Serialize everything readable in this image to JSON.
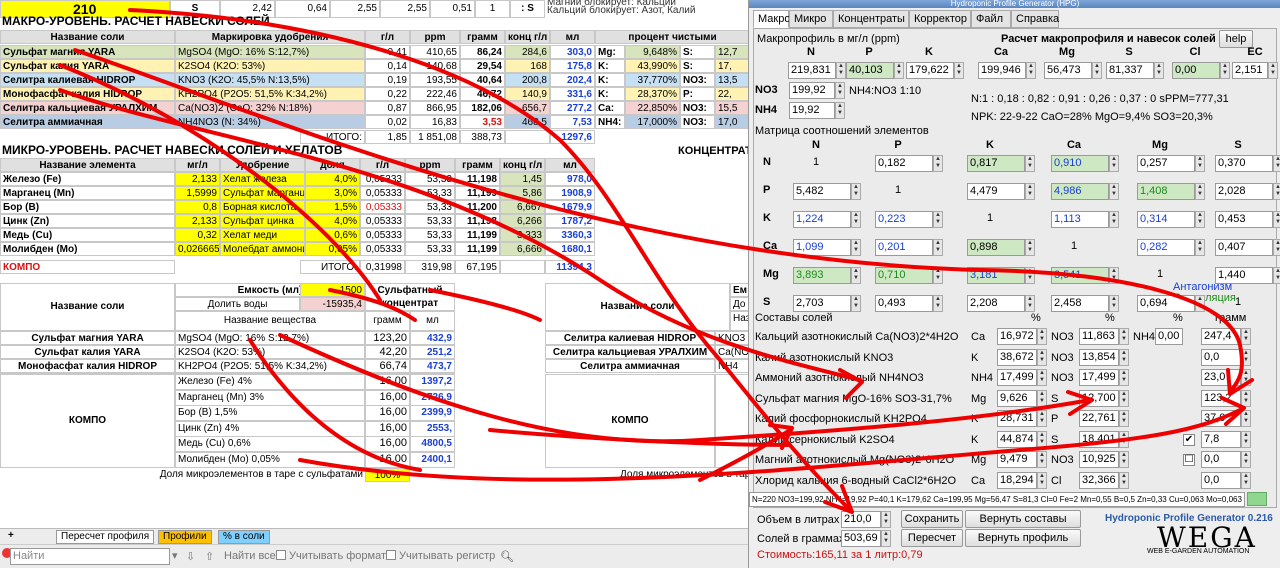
{
  "top": {
    "val210": "210",
    "s1": "S",
    "n1": "2,42",
    "n2": "0,64",
    "n3": "2,55",
    "n4": "2,55",
    "n5": "0,51",
    "n6": "1",
    "s2": ": S",
    "note1": "Магний блокирует: Кальций",
    "note2": "Кальций блокирует: Азот, Калий"
  },
  "macro": {
    "title": "МАКРО-УРОВЕНЬ. РАСЧЕТ НАВЕСКИ СОЛЕЙ",
    "h": [
      "Название соли",
      "Маркировка удобрения",
      "г/л",
      "ppm",
      "грамм",
      "конц г/л",
      "мл",
      "процент чистыми"
    ],
    "rows": [
      {
        "name": "Сульфат магния YARA",
        "mark": "MgSO4 (MgO: 16% S:12,7%)",
        "gl": "0,41",
        "ppm": "410,65",
        "g": "86,24",
        "k": "284,6",
        "ml": "303,0",
        "e1": "Mg:",
        "p1": "9,648%",
        "e2": "S:",
        "p2": "12,7"
      },
      {
        "name": "Сульфат калия YARA",
        "mark": "K2SO4 (K2O: 53%)",
        "gl": "0,14",
        "ppm": "140,68",
        "g": "29,54",
        "k": "168",
        "ml": "175,8",
        "e1": "K:",
        "p1": "43,990%",
        "e2": "S:",
        "p2": "17,"
      },
      {
        "name": "Селитра калиевая HIDROP",
        "mark": "KNO3 (K2O: 45,5% N:13,5%)",
        "gl": "0,19",
        "ppm": "193,55",
        "g": "40,64",
        "k": "200,8",
        "ml": "202,4",
        "e1": "K:",
        "p1": "37,770%",
        "e2": "NO3:",
        "p2": "13,5"
      },
      {
        "name": "Монофасфат калия HIDROP",
        "mark": "KH2PO4 (P2O5: 51,5% K:34,2%)",
        "gl": "0,22",
        "ppm": "222,46",
        "g": "46,72",
        "k": "140,9",
        "ml": "331,6",
        "e1": "K:",
        "p1": "28,370%",
        "e2": "P:",
        "p2": "22,"
      },
      {
        "name": "Селитра кальциевая УРАЛХИМ",
        "mark": "Ca(NO3)2 (CaO: 32% N:18%)",
        "gl": "0,87",
        "ppm": "866,95",
        "g": "182,06",
        "k": "656,7",
        "ml": "277,2",
        "e1": "Ca:",
        "p1": "22,850%",
        "e2": "NO3:",
        "p2": "15,5"
      },
      {
        "name": "Селитра аммиачная",
        "mark": "NH4NO3 (N: 34%)",
        "gl": "0,02",
        "ppm": "16,83",
        "g": "3,53",
        "k": "468,5",
        "ml": "7,53",
        "e1": "NH4:",
        "p1": "17,000%",
        "e2": "NO3:",
        "p2": "17,0"
      }
    ],
    "total_label": "ИТОГО:",
    "total": [
      "1,85",
      "1 851,08",
      "388,73",
      "",
      "1297,6"
    ]
  },
  "micro": {
    "title": "МИКРО-УРОВЕНЬ. РАСЧЕТ НАВЕСКИ СОЛЕЙ И ХЕЛАТОВ",
    "conc": "КОНЦЕНТРАТ",
    "h": [
      "Название элемента",
      "мг/л",
      "Удобрение",
      "доля",
      "г/л",
      "ppm",
      "грамм",
      "конц г/л",
      "мл"
    ],
    "rows": [
      {
        "n": "Железо (Fe)",
        "mg": "2,133",
        "f": "Хелат железа",
        "d": "4,0%",
        "gl": "0,05333",
        "ppm": "53,33",
        "g": "11,198",
        "k": "1,45",
        "ml": "978,0"
      },
      {
        "n": "Марганец (Mn)",
        "mg": "1,5999",
        "f": "Сульфат марганца",
        "d": "3,0%",
        "gl": "0,05333",
        "ppm": "53,33",
        "g": "11,199",
        "k": "5,86",
        "ml": "1908,9"
      },
      {
        "n": "Бор (B)",
        "mg": "0,8",
        "f": "Борная кислота",
        "d": "1,5%",
        "gl": "0,05333",
        "ppm": "53,33",
        "g": "11,200",
        "k": "6,667",
        "ml": "1679,9"
      },
      {
        "n": "Цинк (Zn)",
        "mg": "2,133",
        "f": "Сульфат цинка",
        "d": "4,0%",
        "gl": "0,05333",
        "ppm": "53,33",
        "g": "11,198",
        "k": "6,266",
        "ml": "1787,2"
      },
      {
        "n": "Медь (Cu)",
        "mg": "0,32",
        "f": "Хелат меди",
        "d": "0,6%",
        "gl": "0,05333",
        "ppm": "53,33",
        "g": "11,199",
        "k": "3,333",
        "ml": "3360,3"
      },
      {
        "n": "Молибден (Mo)",
        "mg": "0,026665",
        "f": "Молебдат аммония",
        "d": "0,05%",
        "gl": "0,05333",
        "ppm": "53,33",
        "g": "11,199",
        "k": "6,666",
        "ml": "1680,1"
      }
    ],
    "kompo": "КОМПО",
    "total_label": "ИТОГО:",
    "total": [
      "0,31998",
      "319,98",
      "67,195",
      "",
      "11394,3"
    ]
  },
  "tare": {
    "hdr": "Название соли",
    "cap_l": "Емкость (мл)",
    "cap_v": "1500",
    "dil_l": "Долить воды",
    "dil_v": "-15935,4",
    "sub_l": "Название вещества",
    "conc_l": "Сульфатный концентрат",
    "g": "грамм",
    "ml": "мл",
    "rows": [
      {
        "n": "Сульфат магния YARA",
        "s": "MgSO4 (MgO: 16% S:12,7%)",
        "g": "123,20",
        "ml": "432,9"
      },
      {
        "n": "Сульфат калия YARA",
        "s": "K2SO4 (K2O: 53%)",
        "g": "42,20",
        "ml": "251,2"
      },
      {
        "n": "Монофасфат калия HIDROP",
        "s": "KH2PO4 (P2O5: 51,5% K:34,2%)",
        "g": "66,74",
        "ml": "473,7"
      }
    ],
    "kompo": "КОМПО",
    "krows": [
      {
        "s": "Железо (Fe) 4%",
        "g": "16,00",
        "ml": "1397,2"
      },
      {
        "s": "Марганец (Mn) 3%",
        "g": "16,00",
        "ml": "2726,9"
      },
      {
        "s": "Бор (B) 1,5%",
        "g": "16,00",
        "ml": "2399,9"
      },
      {
        "s": "Цинк (Zn) 4%",
        "g": "16,00",
        "ml": "2553,"
      },
      {
        "s": "Медь (Cu) 0,6%",
        "g": "16,00",
        "ml": "4800,5"
      },
      {
        "s": "Молибден (Mo) 0,05%",
        "g": "16,00",
        "ml": "2400,1"
      }
    ],
    "share_l": "Доля микроэлементов в таре с сульфатами",
    "share_v": "100%",
    "r_hdr": "Название соли",
    "r_rows": [
      "Селитра калиевая HIDROP",
      "Селитра кальциевая УРАЛХИМ",
      "Селитра аммиачная"
    ],
    "r_subs": [
      "KNO3",
      "Ca(NO",
      "NH4"
    ],
    "r_kompo": "КОМПО",
    "r_share": "Доля микроэлементов в таре с",
    "r_cap": "Ем",
    "r_conc": "До",
    "r_sub": "Наз"
  },
  "tabs": [
    "Пересчет профиля",
    "Профили",
    "% в соли"
  ],
  "find": {
    "placeholder": "Найти",
    "all": "Найти все",
    "fmt": "Учитывать формат",
    "reg": "Учитывать регистр"
  },
  "hpg": {
    "title": "Hydroponic Profile Generator (HPG)",
    "menu": [
      "Макро",
      "Микро",
      "Концентраты",
      "Корректор",
      "Файл",
      "Справка"
    ],
    "macro_l": "Макропрофиль в мг/л (ppm)",
    "calc_l": "Расчет макропрофиля и навесок солей",
    "help": "help",
    "heads": [
      "N",
      "P",
      "K",
      "Ca",
      "Mg",
      "S",
      "Cl",
      "EC"
    ],
    "vals": [
      "219,831",
      "40,103",
      "179,622",
      "199,946",
      "56,473",
      "81,337",
      "0,00",
      "2,151"
    ],
    "no3_l": "NO3",
    "no3": "199,92",
    "nh4nl": "NH4:NO3 1:10",
    "nh4_l": "NH4",
    "nh4": "19,92",
    "ratio": "N:1 : 0,18 : 0,82 : 0,91 : 0,26 : 0,37 : 0 sPPM=777,31",
    "npk": "NPK: 22-9-22 CaO=28% MgO=9,4% SO3=20,3%",
    "mtx_l": "Матрица соотношений элементов",
    "mh": [
      "N",
      "P",
      "K",
      "Ca",
      "Mg",
      "S"
    ],
    "rows": [
      {
        "l": "N",
        "c": [
          "1",
          "0,182",
          "0,817",
          "0,910",
          "0,257",
          "0,370"
        ]
      },
      {
        "l": "P",
        "c": [
          "5,482",
          "1",
          "4,479",
          "4,986",
          "1,408",
          "2,028"
        ]
      },
      {
        "l": "K",
        "c": [
          "1,224",
          "0,223",
          "1",
          "1,113",
          "0,314",
          "0,453"
        ]
      },
      {
        "l": "Ca",
        "c": [
          "1,099",
          "0,201",
          "0,898",
          "1",
          "0,282",
          "0,407"
        ]
      },
      {
        "l": "Mg",
        "c": [
          "3,893",
          "0,710",
          "3,181",
          "3,541",
          "1",
          "1,440"
        ]
      },
      {
        "l": "S",
        "c": [
          "2,703",
          "0,493",
          "2,208",
          "2,458",
          "0,694",
          "1"
        ]
      }
    ],
    "antag": "Антагонизм",
    "stim": "Стимуляция",
    "sost_l": "Составы солей",
    "pct": "%",
    "gram": "грамм",
    "salts": [
      {
        "n": "Кальций азотнокислый Ca(NO3)2*4H2O",
        "e1": "Ca",
        "v1": "16,972",
        "e2": "NO3",
        "v2": "11,863",
        "e3": "NH4",
        "v3": "0,00",
        "g": "247,4",
        "chk": ""
      },
      {
        "n": "Калий азотнокислый KNO3",
        "e1": "K",
        "v1": "38,672",
        "e2": "NO3",
        "v2": "13,854",
        "g": "0,0",
        "chk": ""
      },
      {
        "n": "Аммоний азотнокислый NH4NO3",
        "e1": "NH4",
        "v1": "17,499",
        "e2": "NO3",
        "v2": "17,499",
        "g": "23,0",
        "chk": ""
      },
      {
        "n": "Сульфат магния MgO-16% SO3-31,7%",
        "e1": "Mg",
        "v1": "9,626",
        "e2": "S",
        "v2": "12,700",
        "g": "123,2",
        "chk": ""
      },
      {
        "n": "Калий фосфорнокислый KH2PO4",
        "e1": "K",
        "v1": "28,731",
        "e2": "P",
        "v2": "22,761",
        "g": "37,0",
        "chk": ""
      },
      {
        "n": "Калий сернокислый K2SO4",
        "e1": "K",
        "v1": "44,874",
        "e2": "S",
        "v2": "18,401",
        "g": "7,8",
        "chk": "✔"
      },
      {
        "n": "Магний азотнокислый Mg(NO3)2*6H2O",
        "e1": "Mg",
        "v1": "9,479",
        "e2": "NO3",
        "v2": "10,925",
        "g": "0,0",
        "chk": "☐"
      },
      {
        "n": "Хлорид кальция 6-водный CaCl2*6H2O",
        "e1": "Ca",
        "v1": "18,294",
        "e2": "Cl",
        "v2": "32,366",
        "g": "0,0",
        "chk": ""
      }
    ],
    "formula": "N=220 NO3=199,92 NH4=19,92 P=40,1 K=179,62 Ca=199,95 Mg=56,47 S=81,3 Cl=0 Fe=2 Mn=0,55 B=0,5 Zn=0,33 Cu=0,063 Mo=0,063 Co=0 Si=0",
    "vol_l": "Объем в литрах",
    "vol": "210,0",
    "save": "Сохранить",
    "revert": "Вернуть составы",
    "salts_l": "Солей в граммах:",
    "salts_v": "503,69",
    "recalc": "Пересчет",
    "revp": "Вернуть профиль",
    "cost": "Стоимость:165,11 за 1 литр:0,79",
    "ver": "Hydroponic Profile Generator 0.216",
    "logo": "WEGA",
    "logo_sub": "WEB E-GARDEN AUTOMATION"
  },
  "colors": {
    "annotation": "#ee0000",
    "blue": "#1a3fd4",
    "green_cell": "#cde8c2"
  }
}
